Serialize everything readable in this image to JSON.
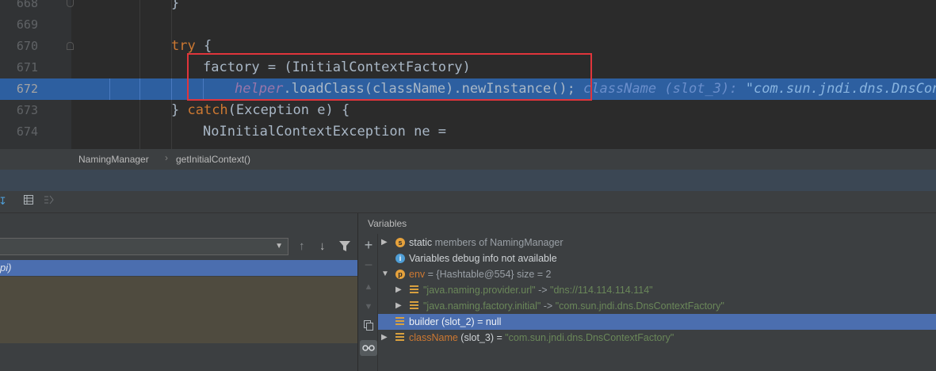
{
  "editor": {
    "lines": [
      {
        "num": "668",
        "text": "}"
      },
      {
        "num": "669",
        "text": ""
      },
      {
        "num": "670",
        "keyword": "try",
        "rest": " {"
      },
      {
        "num": "671",
        "text": "factory = (InitialContextFactory)"
      },
      {
        "num": "672",
        "field": "helper",
        "rest": ".loadClass(className).newInstance();",
        "hint_label": "className (slot_3):",
        "hint_value": "\"com.sun.jndi.dns.DnsCont"
      },
      {
        "num": "673",
        "pre": "} ",
        "keyword": "catch",
        "rest": "(Exception e) {"
      },
      {
        "num": "674",
        "text": "NoInitialContextException ne ="
      }
    ]
  },
  "breadcrumb": {
    "items": [
      "NamingManager",
      "getInitialContext()"
    ]
  },
  "frames": {
    "selected_frame": "pi)"
  },
  "variables": {
    "title": "Variables",
    "rows": [
      {
        "name": "static",
        "rest": "members of NamingManager"
      },
      {
        "text": "Variables debug info not available"
      },
      {
        "name": "env",
        "rest": "= {Hashtable@554}  size = 2"
      },
      {
        "key": "\"java.naming.provider.url\"",
        "arrow": " -> ",
        "value": "\"dns://114.114.114.114\""
      },
      {
        "key": "\"java.naming.factory.initial\"",
        "arrow": " -> ",
        "value": "\"com.sun.jndi.dns.DnsContextFactory\""
      },
      {
        "text": "builder (slot_2) = null"
      },
      {
        "name": "className",
        "rest": " (slot_3) = ",
        "value": "\"com.sun.jndi.dns.DnsContextFactory\""
      }
    ]
  },
  "colors": {
    "editor_bg": "#2b2b2b",
    "exec_line": "#2d5fa0",
    "highlight_box": "#e0353b",
    "selection": "#4b6eaf",
    "keyword": "#cc7832",
    "string": "#6a8759"
  },
  "icons": {
    "toolbar": [
      "step-into-icon",
      "table-icon",
      "restore-layout-icon"
    ],
    "frames_tools": [
      "arrow-up-icon",
      "arrow-down-icon",
      "filter-icon"
    ],
    "vars_side": [
      "add-watch-icon",
      "remove-watch-icon",
      "move-up-icon",
      "move-down-icon",
      "copy-icon",
      "glasses-icon"
    ]
  }
}
